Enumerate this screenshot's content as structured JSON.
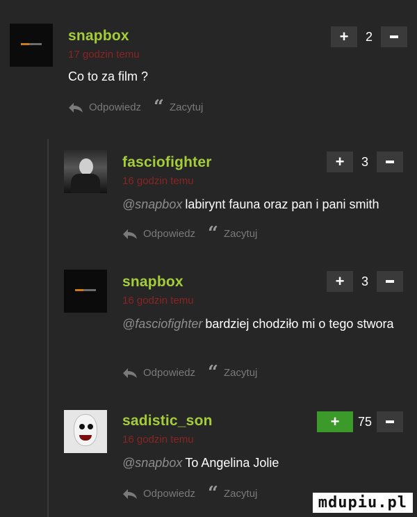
{
  "comments": [
    {
      "username": "snapbox",
      "time": "17 godzin temu",
      "mention": "",
      "text": "Co to za film ?",
      "score": "2",
      "reply": "Odpowiedz",
      "quote": "Zacytuj"
    },
    {
      "username": "fasciofighter",
      "time": "16 godzin temu",
      "mention": "@snapbox",
      "text": "labirynt fauna oraz pan i pani smith",
      "score": "3",
      "reply": "Odpowiedz",
      "quote": "Zacytuj"
    },
    {
      "username": "snapbox",
      "time": "16 godzin temu",
      "mention": "@fasciofighter",
      "text": "bardziej chodziło mi o tego stwora",
      "score": "3",
      "reply": "Odpowiedz",
      "quote": "Zacytuj"
    },
    {
      "username": "sadistic_son",
      "time": "16 godzin temu",
      "mention": "@snapbox",
      "text": "To Angelina Jolie",
      "score": "75",
      "reply": "Odpowiedz",
      "quote": "Zacytuj"
    }
  ],
  "icons": {
    "plus": "+",
    "quote_glyph": "“"
  },
  "colors": {
    "background": "#262626",
    "username": "#a4cd39",
    "timestamp": "#8b2323",
    "vote_active": "#3c9a2a"
  },
  "watermark": "mdupiu.pl"
}
